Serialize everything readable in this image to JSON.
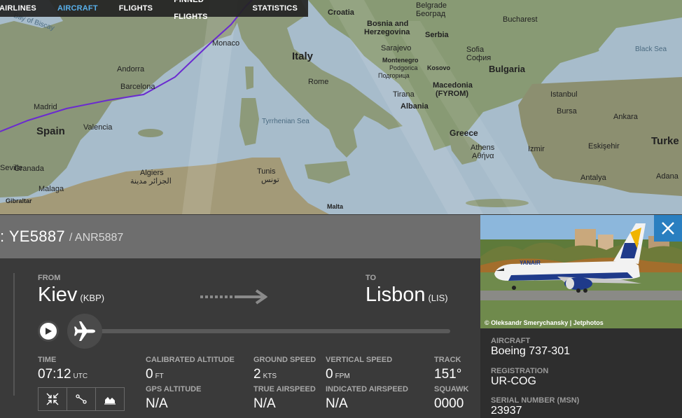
{
  "nav": {
    "items": [
      {
        "label": "AIRLINES",
        "active": false
      },
      {
        "label": "AIRCRAFT",
        "active": true
      },
      {
        "label": "FLIGHTS",
        "active": false
      },
      {
        "label": "PINNED FLIGHTS",
        "active": false
      },
      {
        "label": "STATISTICS",
        "active": false
      }
    ]
  },
  "map": {
    "labels": {
      "bay_of_biscay": "Bay of Biscay",
      "croatia": "Croatia",
      "belgrade": "Belgrade",
      "belgrade_cyr": "Београд",
      "bucharest": "Bucharest",
      "bosnia": "Bosnia and",
      "herzegovina": "Herzegovina",
      "serbia": "Serbia",
      "sarajevo": "Sarajevo",
      "sofia": "Sofia",
      "sofia_cyr": "София",
      "black_sea": "Black Sea",
      "monaco": "Monaco",
      "italy": "Italy",
      "montenegro": "Montenegro",
      "podgorica": "Podgorica",
      "podgorica_cyr": "Подгорица",
      "kosovo": "Kosovo",
      "bulgaria": "Bulgaria",
      "andorra": "Andorra",
      "rome": "Rome",
      "macedonia": "Macedonia",
      "fyrom": "(FYROM)",
      "barcelona": "Barcelona",
      "tirana": "Tirana",
      "albania": "Albania",
      "istanbul": "Istanbul",
      "madrid": "Madrid",
      "bursa": "Bursa",
      "ankara": "Ankara",
      "spain": "Spain",
      "valencia": "Valencia",
      "tyrrhenian": "Tyrrhenian Sea",
      "greece": "Greece",
      "turkey": "Turke",
      "athens": "Athens",
      "athens_gr": "Αθήνα",
      "izmir": "Izmir",
      "eskisehir": "Eskişehir",
      "seville": "Seville",
      "algiers": "Algiers",
      "algiers_ar": "الجزائر مدينة",
      "tunis": "Tunis",
      "tunis_ar": "تونس",
      "granada": "Granada",
      "antalya": "Antalya",
      "adana": "Adana",
      "malaga": "Malaga",
      "gibraltar": "Gibraltar",
      "malta": "Malta"
    }
  },
  "flight": {
    "callsign": "YE5887",
    "alt_callsign": "/ ANR5887",
    "from_label": "FROM",
    "from_city": "Kiev",
    "from_code": "(KBP)",
    "to_label": "TO",
    "to_city": "Lisbon",
    "to_code": "(LIS)",
    "progress": 0
  },
  "stats": {
    "time_label": "TIME",
    "time_value": "07:12",
    "time_unit": "UTC",
    "cal_alt_label": "CALIBRATED ALTITUDE",
    "cal_alt_value": "0",
    "cal_alt_unit": "FT",
    "gps_alt_label": "GPS ALTITUDE",
    "gps_alt_value": "N/A",
    "ground_speed_label": "GROUND SPEED",
    "ground_speed_value": "2",
    "ground_speed_unit": "KTS",
    "true_airspeed_label": "TRUE AIRSPEED",
    "true_airspeed_value": "N/A",
    "vert_speed_label": "VERTICAL SPEED",
    "vert_speed_value": "0",
    "vert_speed_unit": "FPM",
    "ind_airspeed_label": "INDICATED AIRSPEED",
    "ind_airspeed_value": "N/A",
    "track_label": "TRACK",
    "track_value": "151°",
    "squawk_label": "SQUAWK",
    "squawk_value": "0000"
  },
  "aircraft": {
    "photo_credit": "© Oleksandr Smerychansky | Jetphotos",
    "livery_text": "YANAIR",
    "aircraft_label": "AIRCRAFT",
    "aircraft_value": "Boeing 737-301",
    "registration_label": "REGISTRATION",
    "registration_value": "UR-COG",
    "serial_label": "SERIAL NUMBER (MSN)",
    "serial_value": "23937"
  },
  "colors": {
    "accent": "#59b0ea",
    "close_button": "#2a7fc0",
    "flight_path": "#6a2ad0"
  }
}
